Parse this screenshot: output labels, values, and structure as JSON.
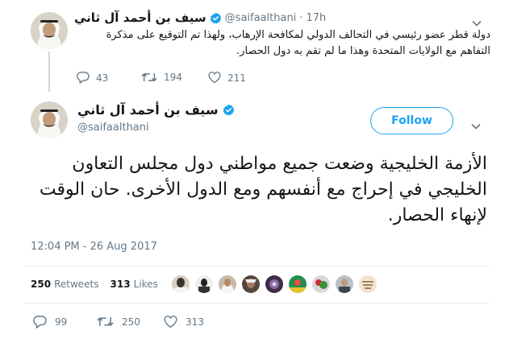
{
  "reply_tweet": {
    "name": "سيف بن أحمد آل ثاني",
    "handle": "@saifaalthani",
    "separator": "·",
    "time": "17h",
    "text": "دولة قطر عضو رئيسي في التحالف الدولي لمكافحة الإرهاب، ولهذا تم التوقيع على مذكرة التفاهم مع الولايات المتحدة وهذا ما لم تقم به دول الحصار.",
    "replies": "43",
    "retweets": "194",
    "likes": "211"
  },
  "main_tweet": {
    "name": "سيف بن أحمد آل ثاني",
    "handle": "@saifaalthani",
    "follow_label": "Follow",
    "text": "الأزمة الخليجية وضعت جميع مواطني دول مجلس التعاون الخليجي في إحراج مع أنفسهم ومع الدول الأخرى. حان الوقت لإنهاء الحصار.",
    "timestamp": "12:04 PM - 26 Aug 2017",
    "retweets_count": "250",
    "retweets_label": "Retweets",
    "likes_count": "313",
    "likes_label": "Likes",
    "replies": "99",
    "retweets": "250",
    "likes": "313"
  },
  "icons": {
    "verified": "verified-badge-icon",
    "reply": "reply-icon",
    "retweet": "retweet-icon",
    "like": "heart-icon",
    "more": "chevron-down-icon"
  },
  "colors": {
    "accent": "#1da1f2",
    "muted": "#657786",
    "text": "#14171a"
  }
}
